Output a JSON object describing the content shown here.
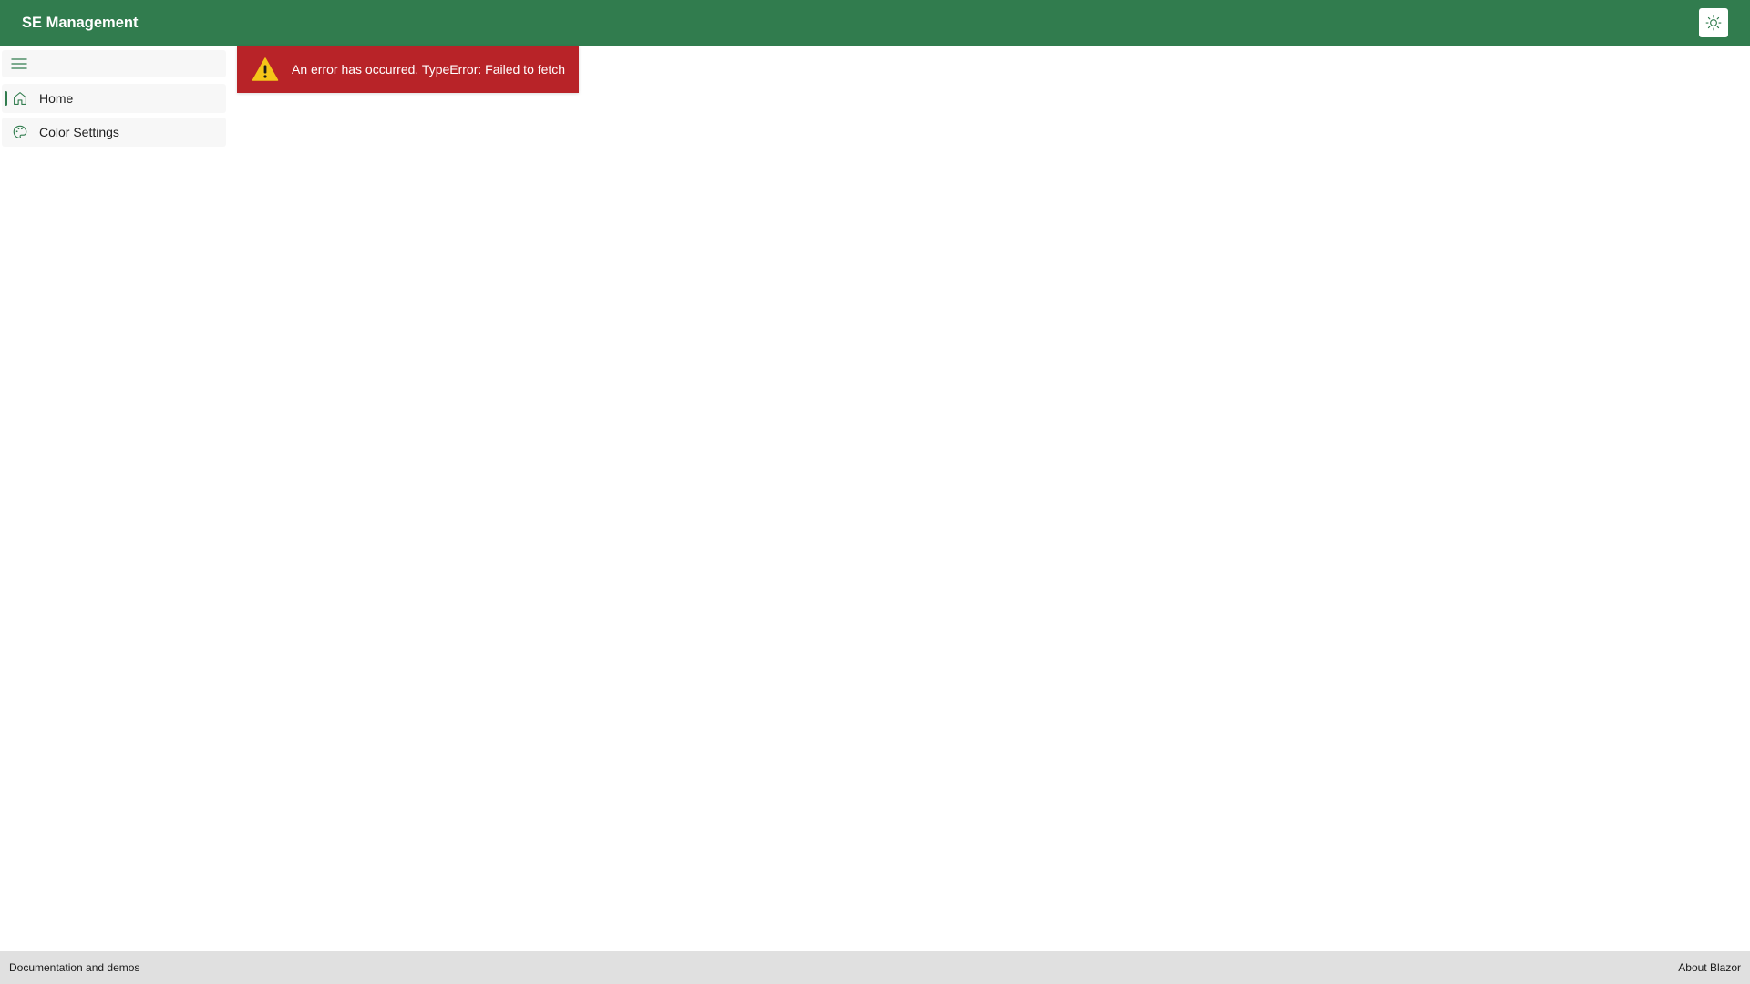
{
  "header": {
    "title": "SE Management",
    "theme_toggle_icon": "sun-icon",
    "background_color": "#317c4e"
  },
  "sidebar": {
    "toggle_icon": "hamburger-menu-icon",
    "items": [
      {
        "label": "Home",
        "icon": "home-icon",
        "active": true
      },
      {
        "label": "Color Settings",
        "icon": "palette-icon",
        "active": false
      }
    ]
  },
  "error": {
    "message": "An error has occurred. TypeError: Failed to fetch",
    "icon": "warning-triangle-icon",
    "background_color": "#b82328"
  },
  "footer": {
    "left_link": "Documentation and demos",
    "right_link": "About Blazor"
  }
}
